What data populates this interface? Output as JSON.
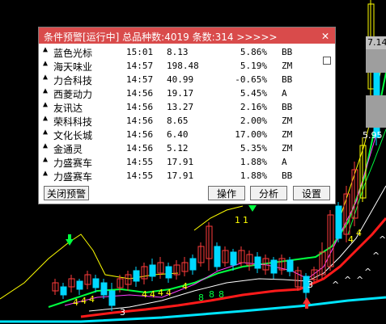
{
  "dialog": {
    "title": "条件预警[运行中] 总品种数:4019 条数:314  >>>>>",
    "close_glyph": "✕",
    "arrow_glyph": "▲",
    "rows": [
      {
        "name": "蓝色光标",
        "time": "15:01",
        "price": "8.13",
        "pct": "5.86%",
        "flag": "BB"
      },
      {
        "name": "海天味业",
        "time": "14:57",
        "price": "198.48",
        "pct": "5.19%",
        "flag": "ZM"
      },
      {
        "name": "力合科技",
        "time": "14:57",
        "price": "40.99",
        "pct": "-0.65%",
        "flag": "BB"
      },
      {
        "name": "西菱动力",
        "time": "14:56",
        "price": "19.17",
        "pct": "5.45%",
        "flag": "A"
      },
      {
        "name": "友讯达",
        "time": "14:56",
        "price": "13.27",
        "pct": "2.16%",
        "flag": "BB"
      },
      {
        "name": "荣科科技",
        "time": "14:56",
        "price": "8.65",
        "pct": "2.00%",
        "flag": "ZM"
      },
      {
        "name": "文化长城",
        "time": "14:56",
        "price": "6.40",
        "pct": "17.00%",
        "flag": "ZM"
      },
      {
        "name": "金通灵",
        "time": "14:56",
        "price": "5.12",
        "pct": "5.35%",
        "flag": "ZM"
      },
      {
        "name": "力盛赛车",
        "time": "14:55",
        "price": "17.91",
        "pct": "1.88%",
        "flag": "A"
      },
      {
        "name": "力盛赛车",
        "time": "14:55",
        "price": "17.91",
        "pct": "1.88%",
        "flag": "BB"
      }
    ],
    "buttons": {
      "close_alert": "关闭预警",
      "operate": "操作",
      "analyze": "分析",
      "settings": "设置"
    }
  },
  "chart": {
    "price_high_label": "7.14",
    "price_mid_label": "5.95",
    "markers": [
      "1",
      "1",
      "3",
      "3",
      "4",
      "4",
      "4",
      "4",
      "4",
      "4",
      "4",
      "4",
      "4",
      "4",
      "8",
      "8",
      "8",
      "^",
      "^",
      "^",
      "^",
      "^",
      "^"
    ]
  },
  "colors": {
    "titlebar": "#d94b4b",
    "up_candle": "#ff3b3b",
    "down_candle": "#00d8ff",
    "ma_yellow": "#ffff00",
    "ma_green": "#00ff40",
    "ma_red": "#ff1a1a",
    "ma_white": "#ffffff",
    "ma_magenta": "#ff40ff",
    "ma_cyan": "#00e5ff"
  }
}
